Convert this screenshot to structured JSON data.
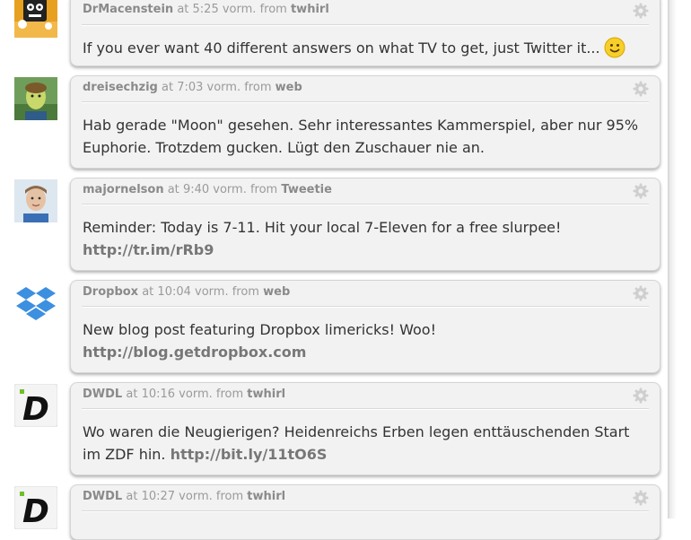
{
  "tweets": [
    {
      "user": "DrMacenstein",
      "at": "at",
      "time": "5:25 vorm.",
      "from": "from",
      "source": "twhirl",
      "text": "If you ever want 40 different answers on what TV to get, just Twitter it...",
      "link": "",
      "emoji": "smiley-emoji",
      "avatar_icon": "drmacenstein-avatar-icon"
    },
    {
      "user": "dreisechzig",
      "at": "at",
      "time": "7:03 vorm.",
      "from": "from",
      "source": "web",
      "text": "Hab gerade \"Moon\" gesehen. Sehr interessantes Kammerspiel, aber nur 95% Euphorie. Trotzdem gucken. Lügt den Zuschauer nie an.",
      "link": "",
      "avatar_icon": "dreisechzig-avatar-icon"
    },
    {
      "user": "majornelson",
      "at": "at",
      "time": "9:40 vorm.",
      "from": "from",
      "source": "Tweetie",
      "text": "Reminder: Today is 7-11. Hit your local 7-Eleven for a free slurpee!",
      "link": "http://tr.im/rRb9",
      "avatar_icon": "majornelson-avatar-icon"
    },
    {
      "user": "Dropbox",
      "at": "at",
      "time": "10:04 vorm.",
      "from": "from",
      "source": "web",
      "text": "New blog post featuring Dropbox limericks! Woo!",
      "link": "http://blog.getdropbox.com",
      "avatar_icon": "dropbox-logo-icon"
    },
    {
      "user": "DWDL",
      "at": "at",
      "time": "10:16 vorm.",
      "from": "from",
      "source": "twhirl",
      "text": "Wo waren die Neugierigen? Heidenreichs Erben legen enttäuschenden Start im ZDF hin.",
      "link": "http://bit.ly/11tO6S",
      "avatar_icon": "dwdl-logo-icon"
    },
    {
      "user": "DWDL",
      "at": "at",
      "time": "10:27 vorm.",
      "from": "from",
      "source": "twhirl",
      "text": "",
      "link": "",
      "avatar_icon": "dwdl-logo-icon"
    }
  ],
  "colors": {
    "bubble_bg": "#f2f2f2",
    "username": "#8a8a8a",
    "meta": "#9a9a9a",
    "text": "#333333",
    "link": "#777777",
    "dropbox_blue": "#3d8fe0"
  }
}
